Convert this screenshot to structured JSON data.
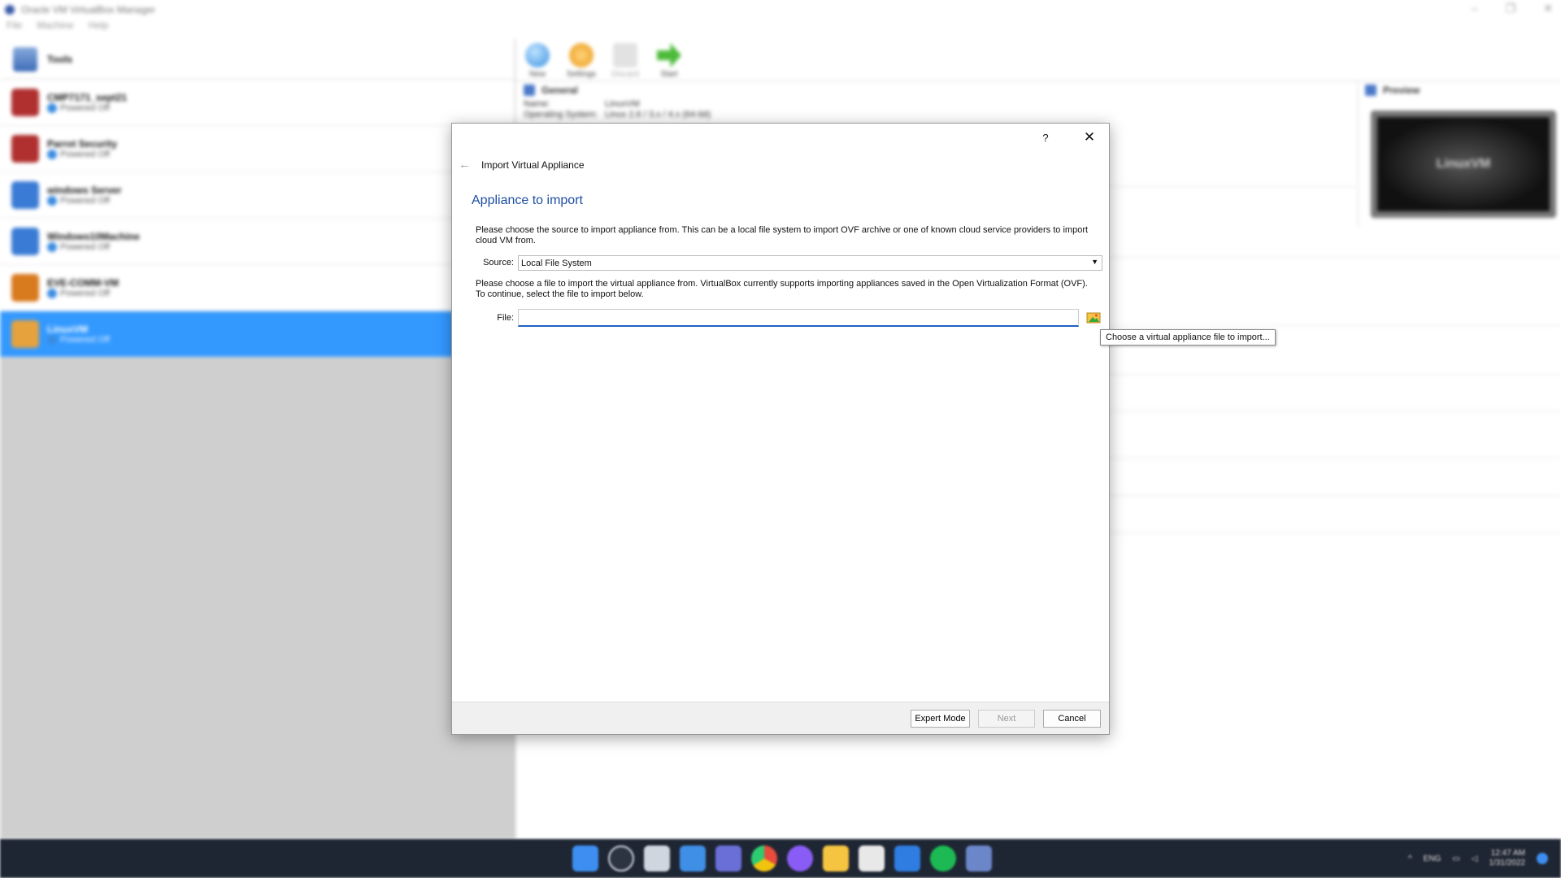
{
  "window": {
    "title": "Oracle VM VirtualBox Manager",
    "minimize": "–",
    "maximize": "❐",
    "close": "✕"
  },
  "menu": [
    "File",
    "Machine",
    "Help"
  ],
  "tools_label": "Tools",
  "vms": [
    {
      "name": "CMP7171_sept21",
      "state": "Powered Off",
      "color": "#c0392b"
    },
    {
      "name": "Parrot Security",
      "state": "Powered Off",
      "color": "#c0392b"
    },
    {
      "name": "windows Server",
      "state": "Powered Off",
      "color": "#3a7bd5"
    },
    {
      "name": "Windows10Machine",
      "state": "Powered Off",
      "color": "#3a7bd5"
    },
    {
      "name": "EVE-COMM-VM",
      "state": "Powered Off",
      "color": "#e67e22"
    },
    {
      "name": "LinuxVM",
      "state": "Powered Off",
      "color": "#e6a23c"
    }
  ],
  "toolbar": {
    "new": "New",
    "settings": "Settings",
    "discard": "Discard",
    "start": "Start"
  },
  "general": {
    "heading": "General",
    "name_key": "Name:",
    "name_value": "LinuxVM",
    "os_key": "Operating System:",
    "os_value": "Linux 2.6 / 3.x / 4.x (64-bit)"
  },
  "preview": {
    "heading": "Preview",
    "screen_text": "LinuxVM"
  },
  "dialog": {
    "help": "?",
    "close": "✕",
    "back": "←",
    "title": "Import Virtual Appliance",
    "heading": "Appliance to import",
    "source_desc": "Please choose the source to import appliance from. This can be a local file system to import OVF archive or one of known cloud service providers to import cloud VM from.",
    "source_label": "Source:",
    "source_value": "Local File System",
    "file_desc": "Please choose a file to import the virtual appliance from. VirtualBox currently supports importing appliances saved in the Open Virtualization Format (OVF). To continue, select the file to import below.",
    "file_label": "File:",
    "file_value": "",
    "tooltip": "Choose a virtual appliance file to import...",
    "buttons": {
      "expert": "Expert Mode",
      "next": "Next",
      "cancel": "Cancel"
    }
  },
  "tray": {
    "lang": "ENG",
    "time": "12:47 AM",
    "date": "1/31/2022"
  },
  "colors": {
    "accent": "#1d4ea2",
    "selection": "#3399ff",
    "taskbar": "#1f2633"
  }
}
